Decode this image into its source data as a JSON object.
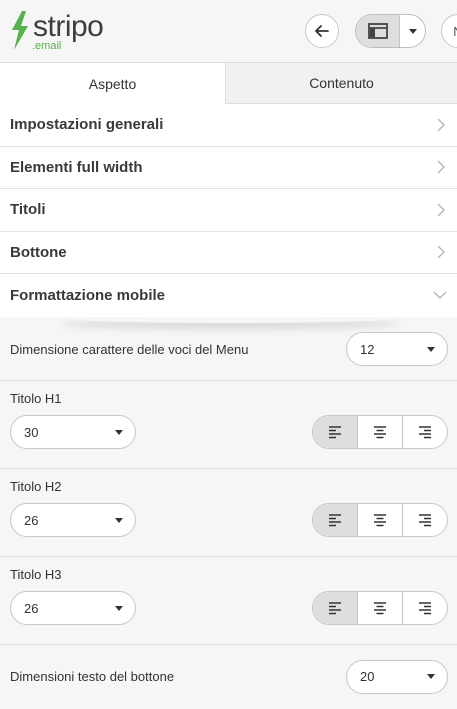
{
  "brand": {
    "name": "stripo",
    "sub": ".email"
  },
  "topbar": {
    "partial_label": "N"
  },
  "tabs": [
    {
      "label": "Aspetto",
      "active": true
    },
    {
      "label": "Contenuto",
      "active": false
    }
  ],
  "sections": [
    {
      "label": "Impostazioni generali",
      "expanded": false
    },
    {
      "label": "Elementi full width",
      "expanded": false
    },
    {
      "label": "Titoli",
      "expanded": false
    },
    {
      "label": "Bottone",
      "expanded": false
    },
    {
      "label": "Formattazione mobile",
      "expanded": true
    }
  ],
  "mobile": {
    "menu_font": {
      "label": "Dimensione carattere delle voci del Menu",
      "value": "12"
    },
    "h1": {
      "label": "Titolo H1",
      "value": "30",
      "align": "left"
    },
    "h2": {
      "label": "Titolo H2",
      "value": "26",
      "align": "left"
    },
    "h3": {
      "label": "Titolo H3",
      "value": "26",
      "align": "left"
    },
    "button_text": {
      "label": "Dimensioni testo del bottone",
      "value": "20"
    }
  },
  "colors": {
    "accent_green": "#57b14d",
    "active_bg": "#dedede",
    "panel_bg": "#f6f6f6"
  }
}
